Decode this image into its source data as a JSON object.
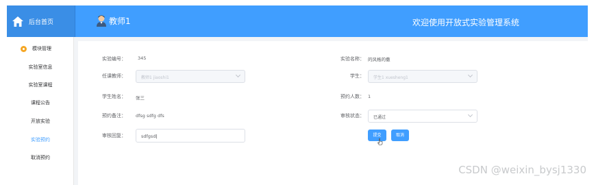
{
  "header": {
    "home_label": "后台首页",
    "user_name": "教师1",
    "system_title": "欢迎使用开放式实验管理系统"
  },
  "sidebar": {
    "group_label": "模块管理",
    "items": [
      {
        "label": "实验室信息"
      },
      {
        "label": "实验室课程"
      },
      {
        "label": "课程公告"
      },
      {
        "label": "开放实验"
      },
      {
        "label": "实验预约"
      },
      {
        "label": "取消预约"
      }
    ],
    "active_index": 4
  },
  "form": {
    "experiment_no_label": "实验编号：",
    "experiment_no_value": "345",
    "experiment_name_label": "实验名称：",
    "experiment_name_value": "的风格的撒",
    "teacher_label": "任课教师：",
    "teacher_value": "教师1 jiaoshi1",
    "student_label": "学生：",
    "student_value": "学生1 xuesheng1",
    "student_name_label": "学生姓名：",
    "student_name_value": "张三",
    "people_label": "预约人数：",
    "people_value": "1",
    "remark_label": "预约备注：",
    "remark_value": "dfsg sdfg dfs",
    "status_label": "审核状态：",
    "status_value": "已通过",
    "reply_label": "审核回复：",
    "reply_value": "sdfgsd",
    "submit_label": "提交",
    "cancel_label": "取消"
  },
  "watermark": "CSDN @weixin_bysj1330",
  "colors": {
    "primary": "#409eff",
    "menu_dot": "#f5a623"
  }
}
